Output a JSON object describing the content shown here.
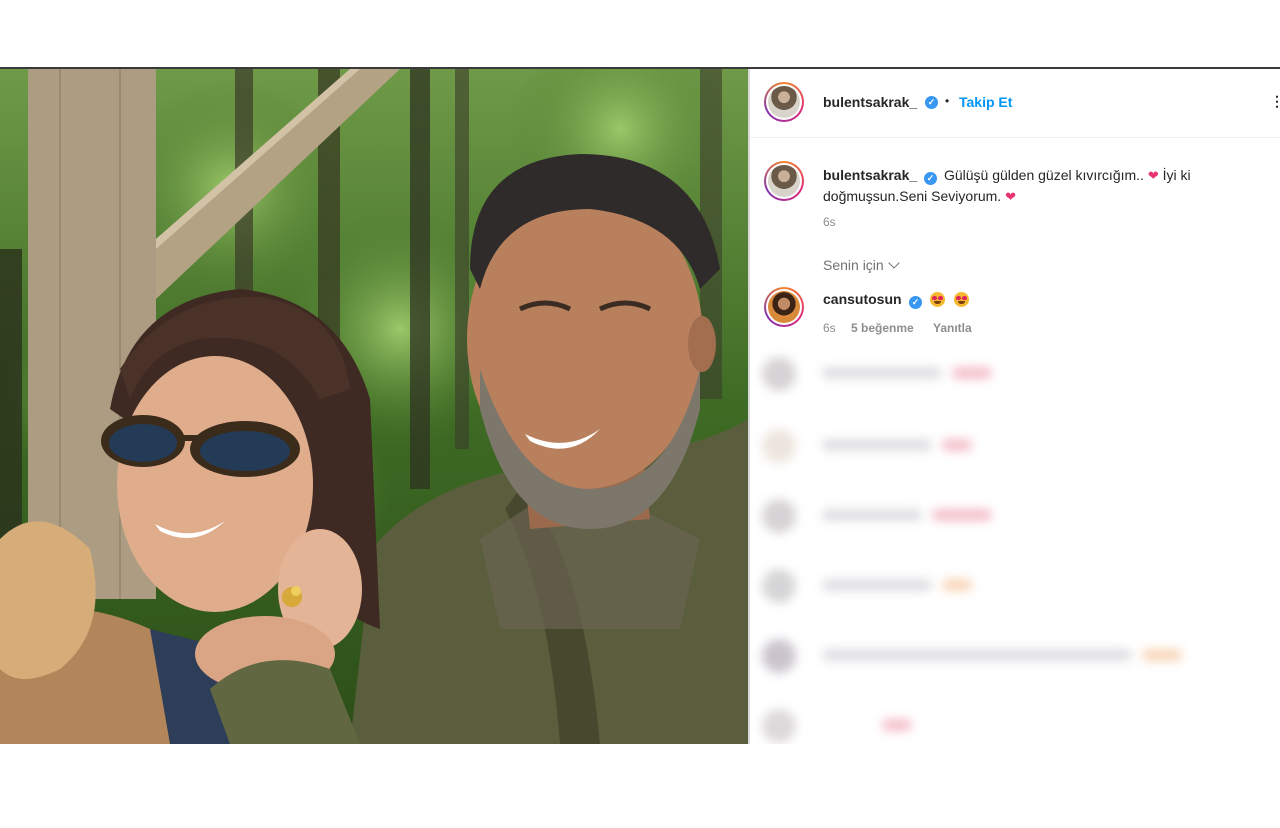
{
  "post": {
    "author": "bulentsakrak_",
    "follow_label": "Takip Et",
    "dot": "•",
    "more_icon": "⋮",
    "caption_author": "bulentsakrak_",
    "caption_text_1": "Gülüşü gülden güzel kıvırcığım..",
    "caption_text_2": "İyi ki doğmuşsun.Seni Seviyorum.",
    "caption_time": "6s"
  },
  "sorting": {
    "label": "Senin için"
  },
  "comments": [
    {
      "user": "cansutosun",
      "emoji_icons": [
        "heart-eyes-emoji",
        "heart-eyes-emoji"
      ],
      "time": "6s",
      "likes": "5 beğenme",
      "reply": "Yanıtla"
    }
  ],
  "colors": {
    "accent": "#0095f6",
    "verified": "#3897f0",
    "heart": "#e8336e",
    "meta": "#8e8e8e"
  }
}
